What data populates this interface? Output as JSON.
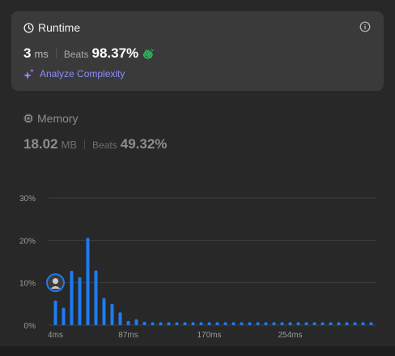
{
  "runtime": {
    "title": "Runtime",
    "value": "3",
    "unit": "ms",
    "beats_label": "Beats",
    "beats_value": "98.37%",
    "analyze_label": "Analyze Complexity",
    "icon": "clock-icon",
    "info_icon": "info-icon"
  },
  "memory": {
    "title": "Memory",
    "value": "18.02",
    "unit": "MB",
    "beats_label": "Beats",
    "beats_value": "49.32%",
    "icon": "chip-icon"
  },
  "colors": {
    "bar": "#1d7cf2",
    "accent": "#8a8cff",
    "clap": "#2cbb5d"
  },
  "chart_data": {
    "type": "bar",
    "y_tick_labels": [
      "30%",
      "20%",
      "10%",
      "0%"
    ],
    "y_ticks": [
      30,
      20,
      10,
      0
    ],
    "ylim": [
      0,
      30
    ],
    "x_tick_labels": [
      "4ms",
      "87ms",
      "170ms",
      "254ms"
    ],
    "x_tick_bar_index": [
      0,
      9,
      19,
      29
    ],
    "values": [
      5.8,
      4.1,
      12.8,
      11.3,
      20.6,
      12.9,
      6.4,
      5.0,
      3.0,
      1.0,
      1.4,
      0.8,
      0.7,
      0.7,
      0.7,
      0.7,
      0.7,
      0.7,
      0.7,
      0.7,
      0.7,
      0.7,
      0.7,
      0.7,
      0.7,
      0.7,
      0.7,
      0.7,
      0.7,
      0.7,
      0.7,
      0.7,
      0.7,
      0.7,
      0.7,
      0.7,
      0.7,
      0.7,
      0.7,
      0.7
    ],
    "user_bar_index": 0,
    "grid": true
  }
}
